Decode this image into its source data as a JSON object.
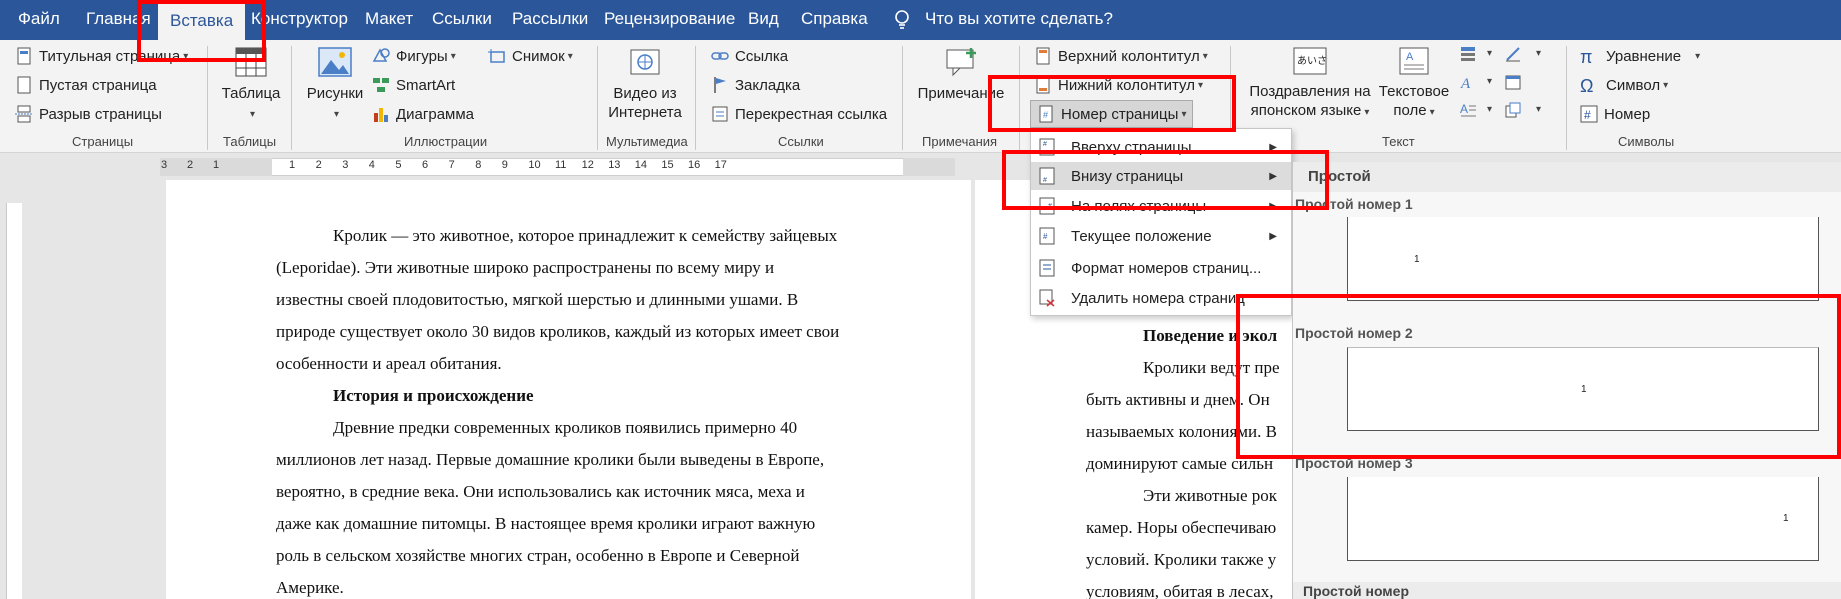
{
  "tabs": [
    "Файл",
    "Главная",
    "Вставка",
    "Конструктор",
    "Макет",
    "Ссылки",
    "Рассылки",
    "Рецензирование",
    "Вид",
    "Справка"
  ],
  "active_tab": "Вставка",
  "tell_me": "Что вы хотите сделать?",
  "ribbon": {
    "pages": {
      "title_page": "Титульная страница",
      "blank_page": "Пустая страница",
      "page_break": "Разрыв страницы",
      "label": "Страницы"
    },
    "tables": {
      "table": "Таблица",
      "label": "Таблицы"
    },
    "illustrations": {
      "pictures": "Рисунки",
      "shapes": "Фигуры",
      "smartart": "SmartArt",
      "chart": "Диаграмма",
      "screenshot": "Снимок",
      "label": "Иллюстрации"
    },
    "media": {
      "video_line1": "Видео из",
      "video_line2": "Интернета",
      "label": "Мультимедиа"
    },
    "links": {
      "link": "Ссылка",
      "bookmark": "Закладка",
      "cross_ref": "Перекрестная ссылка",
      "label": "Ссылки"
    },
    "comments": {
      "comment": "Примечание",
      "label": "Примечания"
    },
    "header_footer": {
      "header": "Верхний колонтитул",
      "footer": "Нижний колонтитул",
      "page_number": "Номер страницы"
    },
    "text": {
      "greeting_line1": "Поздравления на",
      "greeting_line2": "японском языке",
      "textbox_line1": "Текстовое",
      "textbox_line2": "поле",
      "greeting_icon_text": "あいさつ",
      "label": "Текст"
    },
    "symbols": {
      "equation": "Уравнение",
      "symbol": "Символ",
      "number": "Номер",
      "label": "Символы"
    }
  },
  "page_number_menu": [
    {
      "label": "Вверху страницы",
      "submenu": true
    },
    {
      "label": "Внизу страницы",
      "submenu": true
    },
    {
      "label": "На полях страницы",
      "submenu": true
    },
    {
      "label": "Текущее положение",
      "submenu": true
    },
    {
      "label": "Формат номеров страниц...",
      "submenu": false
    },
    {
      "label": "Удалить номера страниц",
      "submenu": false
    }
  ],
  "gallery": {
    "header": "Простой",
    "items": [
      {
        "title": "Простой номер 1",
        "number": "1",
        "align": "left"
      },
      {
        "title": "Простой номер 2",
        "number": "1",
        "align": "center"
      },
      {
        "title": "Простой номер 3",
        "number": "1",
        "align": "right"
      }
    ],
    "footer": "Простой номер"
  },
  "ruler_numbers": [
    "3",
    "2",
    "1",
    "1",
    "2",
    "3",
    "4",
    "5",
    "6",
    "7",
    "8",
    "9",
    "10",
    "11",
    "12",
    "13",
    "14",
    "15",
    "16",
    "17"
  ],
  "document_left": [
    "Кролик — это животное, которое принадлежит к семейству зайцевых",
    "(Leporidae). Эти животные широко распространены по всему миру и",
    "известны своей плодовитостью, мягкой шерстью и длинными ушами. В",
    "природе существует около 30 видов кроликов, каждый из которых имеет свои",
    "особенности и ареал обитания.",
    "История и происхождение",
    "Древние предки современных кроликов появились примерно 40",
    "миллионов лет назад. Первые домашние кролики были выведены в Европе,",
    "вероятно, в средние века. Они использовались как источник мяса, меха и",
    "даже как домашние питомцы. В настоящее время кролики играют важную",
    "роль в сельском хозяйстве многих стран, особенно в Европе и Северной",
    "Америке."
  ],
  "document_right": [
    "Поведение и экол",
    "Кролики ведут пре",
    "быть активны и днем. Он",
    "называемых колониями. В",
    "доминируют самые сильн",
    "Эти животные рок",
    "камер. Норы обеспечиваю",
    "условий. Кролики также у",
    "условиям, обитая в лесах,"
  ],
  "colors": {
    "accent": "#2b579a",
    "highlight": "#ff0000",
    "ribbon_bg": "#f3f3f3"
  }
}
